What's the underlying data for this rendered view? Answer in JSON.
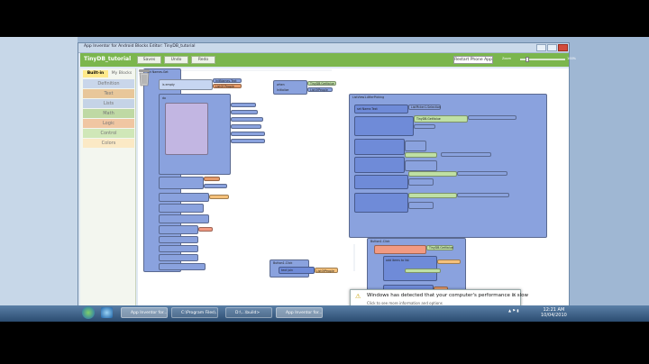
{
  "window": {
    "title": "App Inventor for Android Blocks Editor: TinyDB_tutorial"
  },
  "header": {
    "project": "TinyDB_tutorial",
    "buttons": [
      "Saves",
      "Undo",
      "Redo"
    ],
    "restart": "Restart Phone App",
    "zoom_label": "Zoom",
    "zoom_max": "100%"
  },
  "palette": {
    "tab_builtin": "Built-in",
    "tab_my": "My Blocks",
    "items": [
      "Definition",
      "Text",
      "Lists",
      "Math",
      "Logic",
      "Control",
      "Colors"
    ],
    "colors": [
      "#c9d6ea",
      "#e8c79a",
      "#c5d3e6",
      "#bfd9a4",
      "#f0c6a2",
      "#d0e7b8",
      "#fbe9c5"
    ]
  },
  "blocks": {
    "b1_title": "set Names.Get",
    "b1_a": "do",
    "b1_b": "is empty",
    "b1_c": "InitNames.Text",
    "b1_d": "ListOf People",
    "b2_title": "when",
    "b2_a": "Initialize",
    "b2_b": "TinyDB.GetValue",
    "b2_c": "ListOfPeople",
    "b3_title": "ListView1.AfterPicking",
    "b3_a": "set Name.Text",
    "b3_b": "TinyDB.GetValue",
    "b3_c": "ListPicker1.Selection",
    "b4_title": "Button1.Click",
    "b4_a": "TinyDB.GetValue",
    "b4_b": "add items to list",
    "b5_title": "Button1.Click",
    "b5_a": "text join",
    "b5_b": "ListOfPeople"
  },
  "notification": {
    "title": "Windows has detected that your computer's performance is slow",
    "sub": "Click to see more information and options"
  },
  "taskbar": {
    "items": [
      "App Inventor for...",
      "C:\\Program Files\\...",
      "D:\\...\\build>",
      "App Inventor for..."
    ],
    "time": "12:21 AM",
    "date": "10/04/2010"
  },
  "colors": {
    "accent": "#7bb64d",
    "logic": "#f29a82",
    "procedure": "#c2b6e2",
    "list": "#8aa2de",
    "text": "#f5c17b",
    "variable": "#e59b6b"
  }
}
